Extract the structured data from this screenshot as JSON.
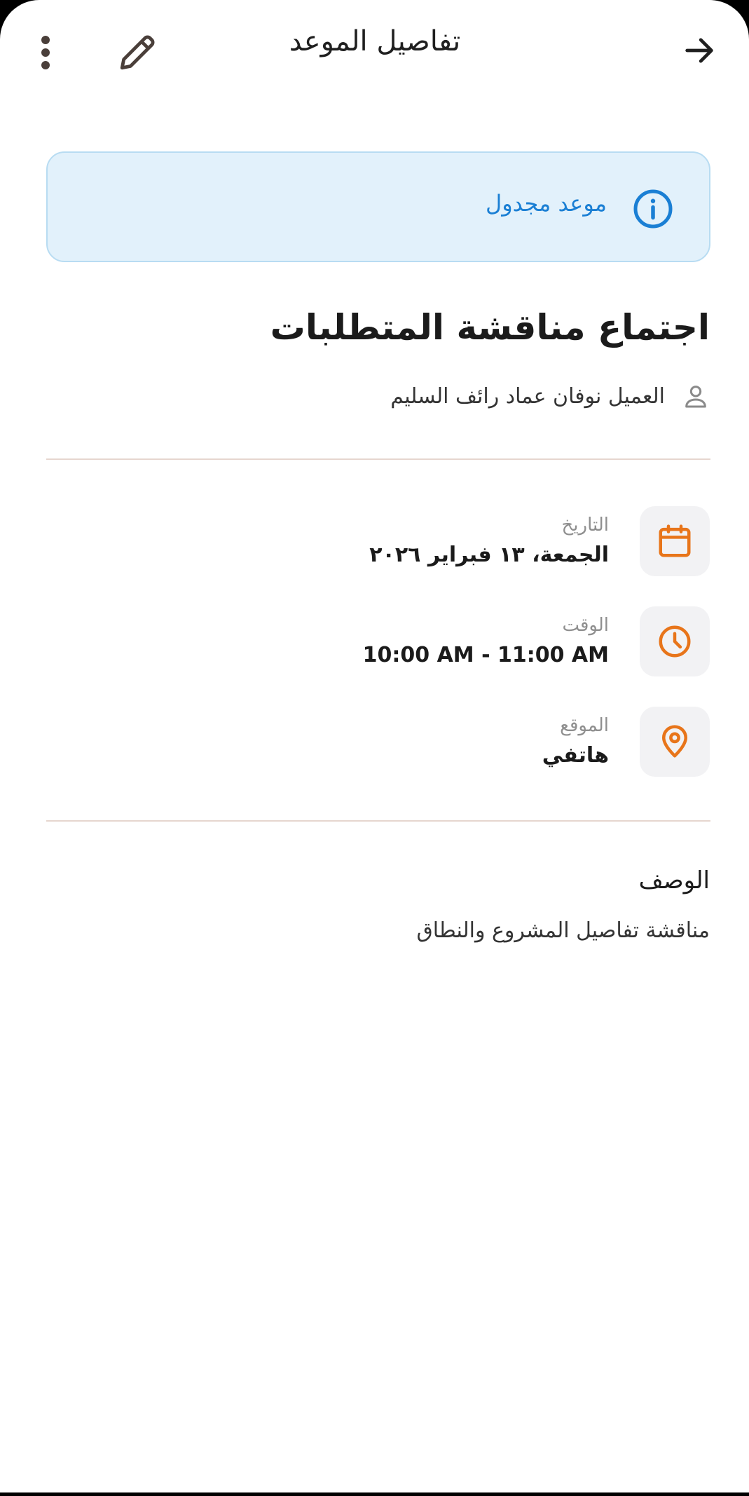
{
  "appbar": {
    "title": "تفاصيل الموعد",
    "back_icon": "arrow-right-icon",
    "edit_icon": "pencil-icon",
    "more_icon": "more-vertical-icon"
  },
  "status": {
    "text": "موعد مجدول",
    "icon": "info-icon",
    "color": "#1a7fd4",
    "background": "#e2f1fb"
  },
  "appointment": {
    "title": "اجتماع مناقشة المتطلبات",
    "client": "العميل نوفان عماد رائف السليم",
    "client_icon": "person-icon"
  },
  "details": [
    {
      "label": "التاريخ",
      "value": "الجمعة، ١٣ فبراير ٢٠٢٦",
      "icon": "calendar-icon"
    },
    {
      "label": "الوقت",
      "value": "10:00 AM - 11:00 AM",
      "icon": "clock-icon"
    },
    {
      "label": "الموقع",
      "value": "هاتفي",
      "icon": "location-pin-icon"
    }
  ],
  "description": {
    "heading": "الوصف",
    "text": "مناقشة تفاصيل المشروع والنطاق"
  },
  "colors": {
    "accent": "#e8751a",
    "divider": "#e6d6cf",
    "icon_box": "#f2f2f4"
  }
}
